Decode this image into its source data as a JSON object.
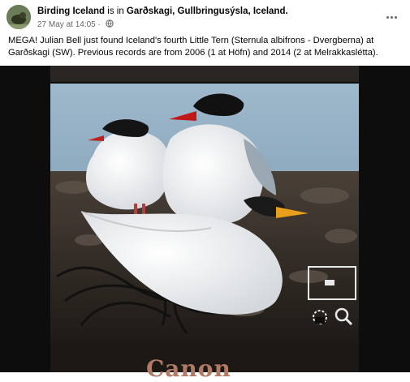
{
  "post": {
    "page_name": "Birding Iceland",
    "in_text": " is in ",
    "location": "Garðskagi, Gullbringusýsla, Iceland.",
    "timestamp": "27 May at 14:05",
    "separator": " · ",
    "body": "MEGA! Julian Bell just found Iceland's fourth Little Tern (Sternula albifrons - Dvergberna) at Garðskagi (SW). Previous records are from 2006 (1 at Höfn) and 2014 (2 at Melrakkaslétta)."
  },
  "photo": {
    "camera_brand": "Canon",
    "icons": [
      "zoom-out-icon",
      "magnify-icon",
      "playback-thumbnail-icon"
    ]
  },
  "colors": {
    "text": "#050505",
    "muted": "#65676b",
    "tern_bill": "#e8a01c"
  }
}
